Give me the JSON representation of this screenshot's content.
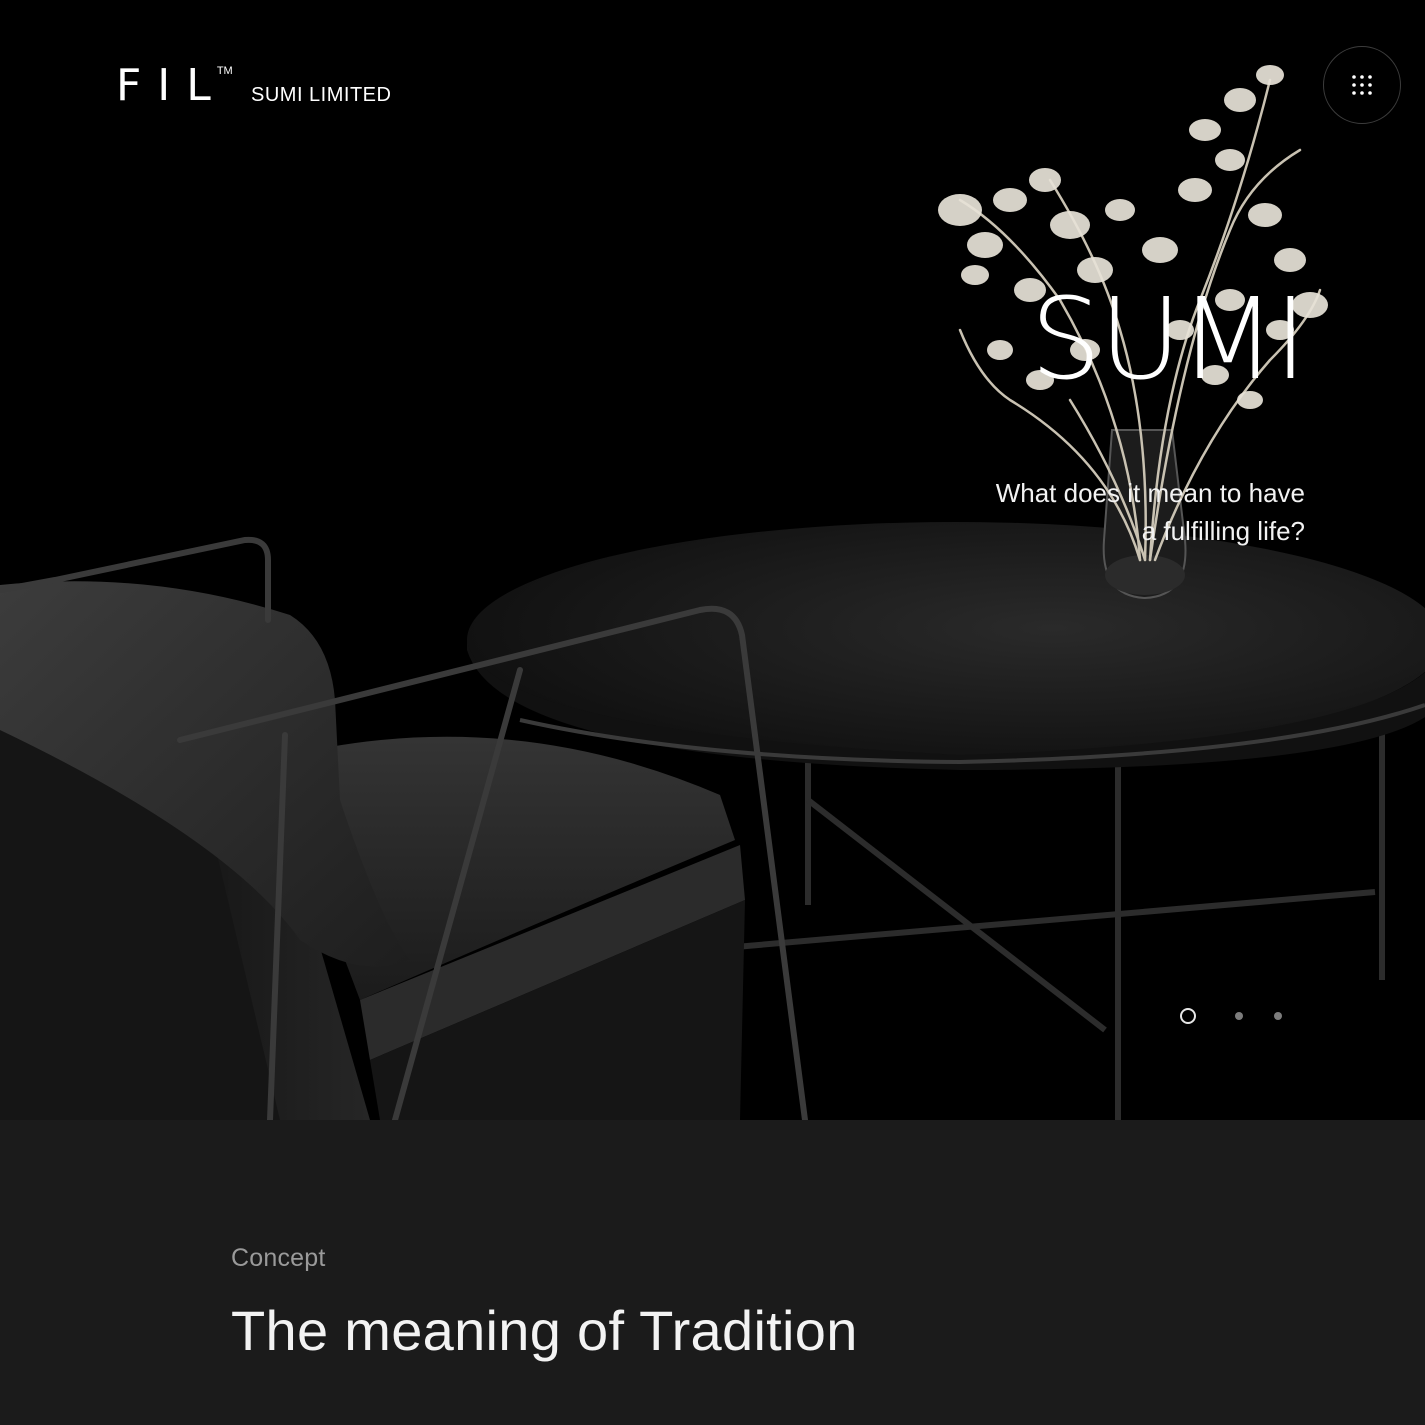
{
  "brand": {
    "mark": "FIL",
    "trademark": "TM",
    "name": "SUMI LIMITED"
  },
  "header": {
    "menu_icon": "grid-dots-icon"
  },
  "hero": {
    "title": "SUMI",
    "tagline": "What does it mean to have a fulfilling life?",
    "image": "dark-lounge-chair-and-round-table-with-dried-flowers",
    "slides_total": 3,
    "active_slide": 1
  },
  "concept": {
    "label": "Concept",
    "heading": "The meaning of Tradition"
  },
  "colors": {
    "background": "#000000",
    "panel": "#1b1b1b",
    "text": "#ffffff",
    "muted": "#9a9a9a"
  }
}
